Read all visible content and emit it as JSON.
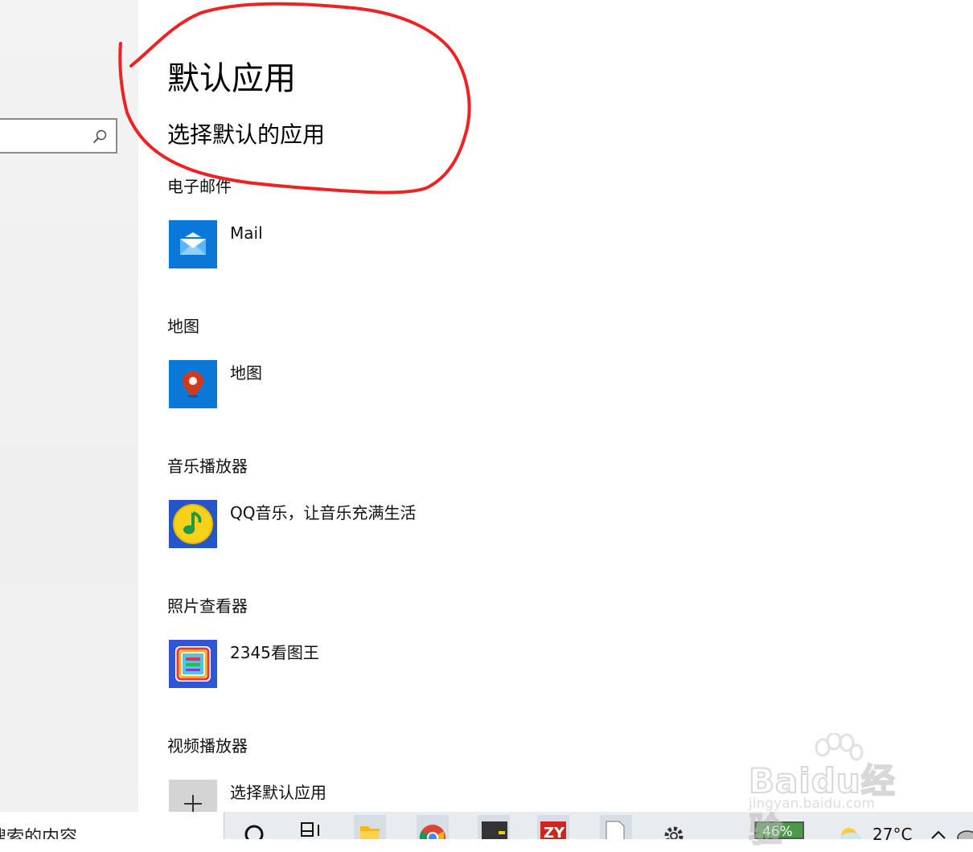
{
  "header": {
    "title": "默认应用",
    "subtitle": "选择默认的应用"
  },
  "sections": [
    {
      "label": "电子邮件",
      "app_name": "Mail",
      "icon": "mail-icon",
      "tile_color": "#0a78d7"
    },
    {
      "label": "地图",
      "app_name": "地图",
      "icon": "map-pin-icon",
      "tile_color": "#0a78d7"
    },
    {
      "label": "音乐播放器",
      "app_name": "QQ音乐，让音乐充满生活",
      "icon": "qq-music-icon",
      "tile_color": "#2356c8"
    },
    {
      "label": "照片查看器",
      "app_name": "2345看图王",
      "icon": "2345-viewer-icon",
      "tile_color": "#2f56d6"
    },
    {
      "label": "视频播放器",
      "app_name": "选择默认应用",
      "icon": "plus-icon",
      "tile_color": "#cfcfcf"
    }
  ],
  "sidebar": {
    "search_icon": "search-icon"
  },
  "taskbar": {
    "search_text": "搜索的内容",
    "battery_percent": "46%",
    "temperature": "27°C",
    "icons": [
      "search-icon",
      "task-view-icon",
      "file-explorer-icon",
      "chrome-icon",
      "app-icon",
      "zy-app-icon",
      "document-icon",
      "settings-icon"
    ]
  },
  "watermark": {
    "brand": "Baidu经验",
    "url": "jingyan.baidu.com"
  },
  "colors": {
    "annotation_circle": "#ee2222",
    "accent_blue": "#0a78d7"
  }
}
